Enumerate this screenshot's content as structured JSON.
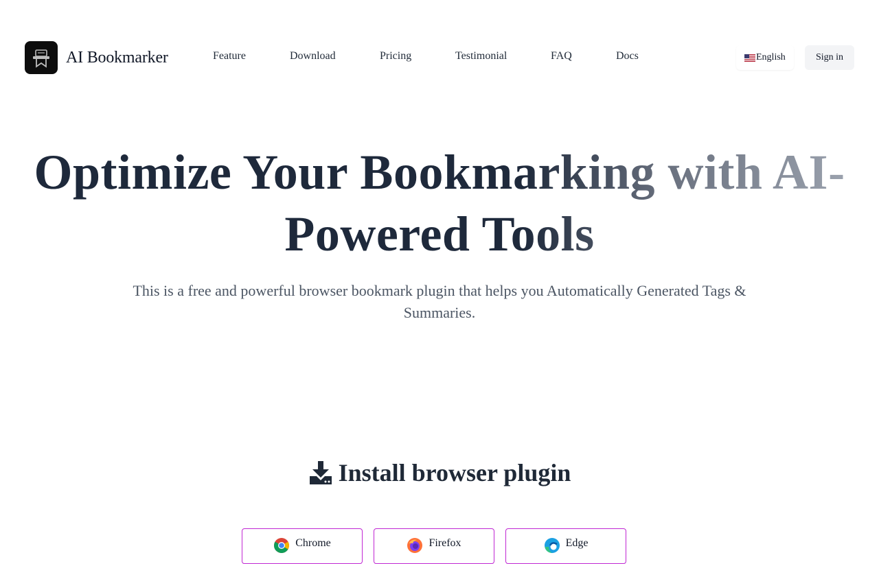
{
  "brand": {
    "name": "AI Bookmarker",
    "logo_icon": "bookmark-robot-icon"
  },
  "nav": {
    "items": [
      {
        "label": "Feature"
      },
      {
        "label": "Download"
      },
      {
        "label": "Pricing"
      },
      {
        "label": "Testimonial"
      },
      {
        "label": "FAQ"
      },
      {
        "label": "Docs"
      }
    ]
  },
  "header": {
    "language_label": "English",
    "language_flag_icon": "us-flag-icon",
    "signin_label": "Sign in"
  },
  "hero": {
    "title": "Optimize Your Bookmarking with AI-Powered Tools",
    "subtitle": "This is a free and powerful browser bookmark plugin that helps you Automatically Generated Tags & Summaries."
  },
  "install": {
    "title": "Install browser plugin",
    "title_icon": "download-icon",
    "browsers": [
      {
        "label": "Chrome",
        "icon": "chrome-icon"
      },
      {
        "label": "Firefox",
        "icon": "firefox-icon"
      },
      {
        "label": "Edge",
        "icon": "edge-icon"
      }
    ]
  },
  "colors": {
    "title_dark": "#1e293b",
    "title_fade": "#9ca3af",
    "subtitle": "#4b5563",
    "browser_border": "#c026d3",
    "signin_bg": "#f3f4f6"
  }
}
